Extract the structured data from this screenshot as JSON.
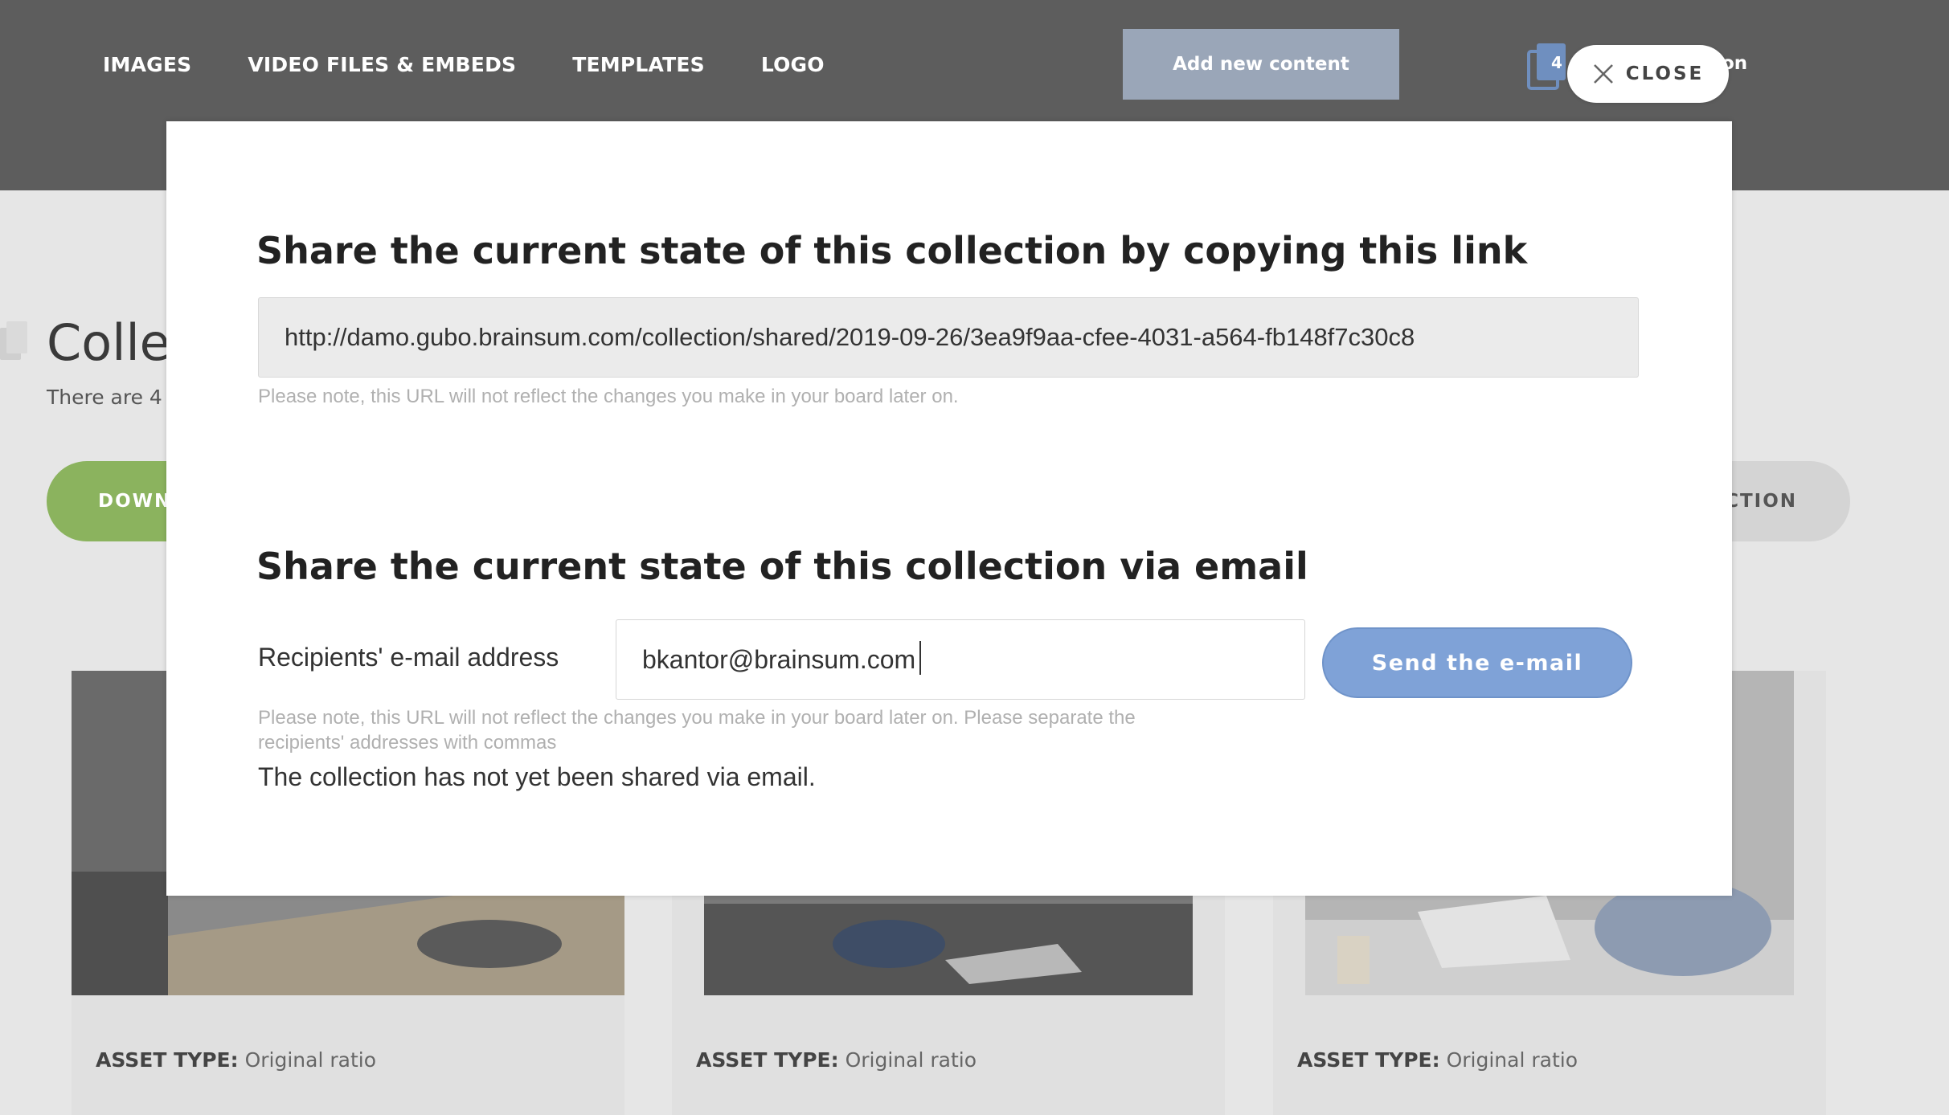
{
  "nav": {
    "items": [
      "IMAGES",
      "VIDEO FILES & EMBEDS",
      "TEMPLATES",
      "LOGO"
    ],
    "add_button": "Add new content",
    "collection_count": "4",
    "collection_label_fragment": "on",
    "close_label": "CLOSE"
  },
  "page": {
    "title_fragment": "Colle",
    "subtitle_fragment": "There are 4",
    "download_button_fragment": "DOWN",
    "right_button_fragment": "CTION"
  },
  "cards": [
    {
      "meta_label": "ASSET TYPE:",
      "meta_value": "Original ratio"
    },
    {
      "meta_label": "ASSET TYPE:",
      "meta_value": "Original ratio"
    },
    {
      "meta_label": "ASSET TYPE:",
      "meta_value": "Original ratio"
    }
  ],
  "modal": {
    "link_heading": "Share the current state of this collection by copying this link",
    "share_url": "http://damo.gubo.brainsum.com/collection/shared/2019-09-26/3ea9f9aa-cfee-4031-a564-fb148f7c30c8",
    "link_note": "Please note, this URL will not reflect the changes you make in your board later on.",
    "email_heading": "Share the current state of this collection via email",
    "email_label": "Recipients' e-mail address",
    "email_value": "bkantor@brainsum.com",
    "send_button": "Send the e-mail",
    "email_note_line1": "Please note, this URL will not reflect the changes you make in your board later on. Please separate the",
    "email_note_line2": "recipients' addresses with commas",
    "status": "The collection has not yet been shared via email."
  },
  "colors": {
    "topbar": "#5d5d5d",
    "accent_send": "#7fa2d7",
    "download_green": "#8bb35e"
  }
}
